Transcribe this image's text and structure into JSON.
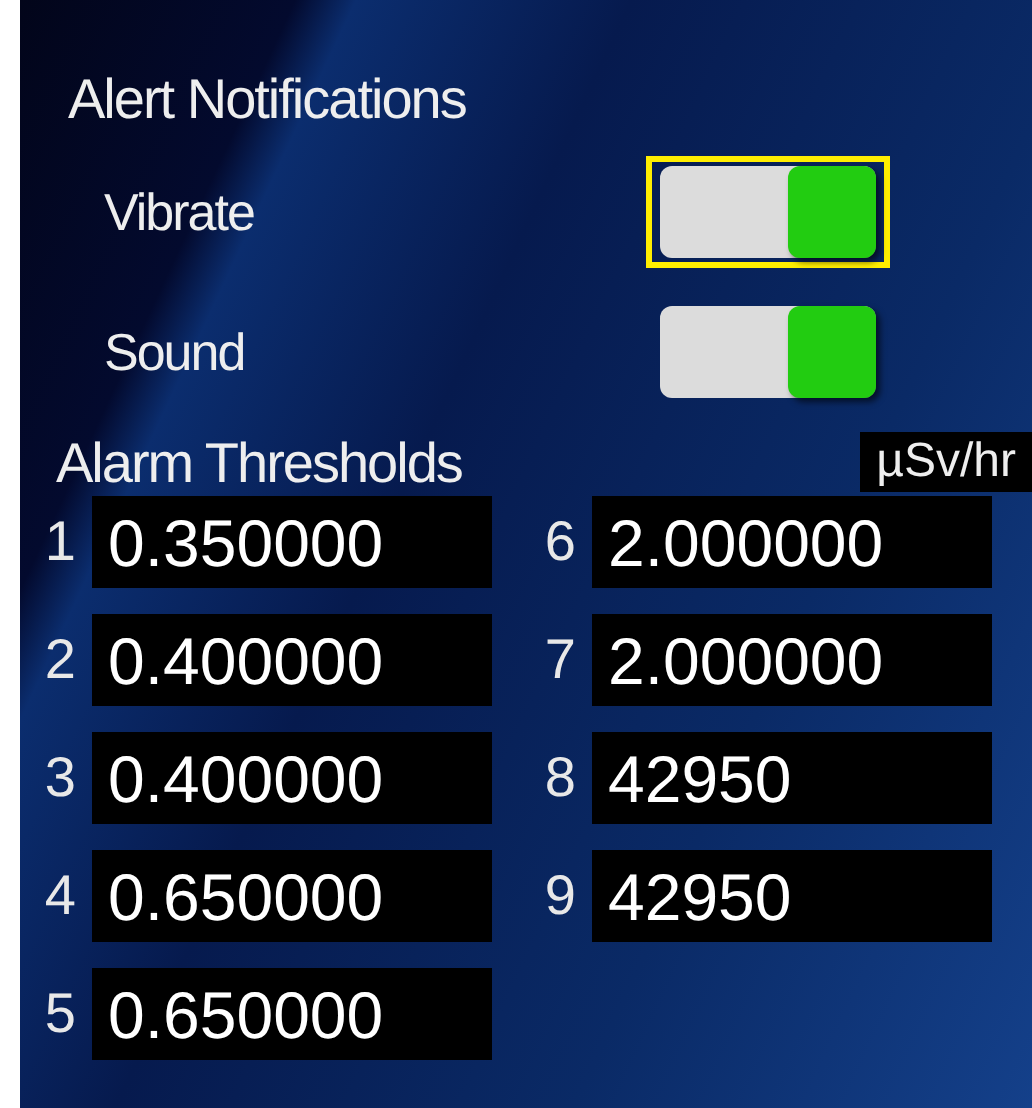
{
  "alert_notifications": {
    "title": "Alert Notifications",
    "toggles": [
      {
        "label": "Vibrate",
        "on": true,
        "focused": true
      },
      {
        "label": "Sound",
        "on": true,
        "focused": false
      }
    ]
  },
  "alarm_thresholds": {
    "title": "Alarm Thresholds",
    "unit": "µSv/hr",
    "fields": [
      {
        "index": "1",
        "value": "0.350000"
      },
      {
        "index": "2",
        "value": "0.400000"
      },
      {
        "index": "3",
        "value": "0.400000"
      },
      {
        "index": "4",
        "value": "0.650000"
      },
      {
        "index": "5",
        "value": "0.650000"
      },
      {
        "index": "6",
        "value": "2.000000"
      },
      {
        "index": "7",
        "value": "2.000000"
      },
      {
        "index": "8",
        "value": "42950"
      },
      {
        "index": "9",
        "value": "42950"
      }
    ]
  }
}
